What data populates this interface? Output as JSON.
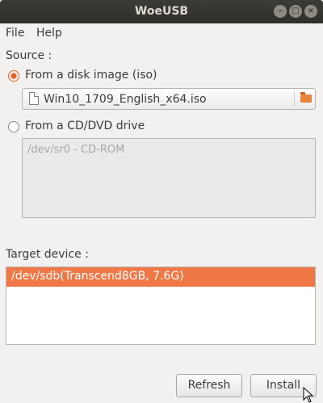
{
  "window": {
    "title": "WoeUSB"
  },
  "menu": {
    "items": [
      "File",
      "Help"
    ]
  },
  "source": {
    "label": "Source :",
    "disk_image_option": "From a disk image (iso)",
    "file_value": "Win10_1709_English_x64.iso",
    "cd_option": "From a CD/DVD drive",
    "cd_items": [
      "/dev/sr0 - CD-ROM"
    ],
    "selected": "disk_image"
  },
  "target": {
    "label": "Target device :",
    "devices": [
      "/dev/sdb(Transcend8GB, 7.6G)"
    ],
    "selected_index": 0
  },
  "buttons": {
    "refresh": "Refresh",
    "install": "Install"
  },
  "colors": {
    "accent": "#f07746",
    "titlebar": "#3c3b37"
  },
  "icons": {
    "file": "file-icon",
    "folder": "folder-icon",
    "close": "close-icon",
    "minimize": "minimize-icon",
    "maximize": "maximize-icon"
  }
}
